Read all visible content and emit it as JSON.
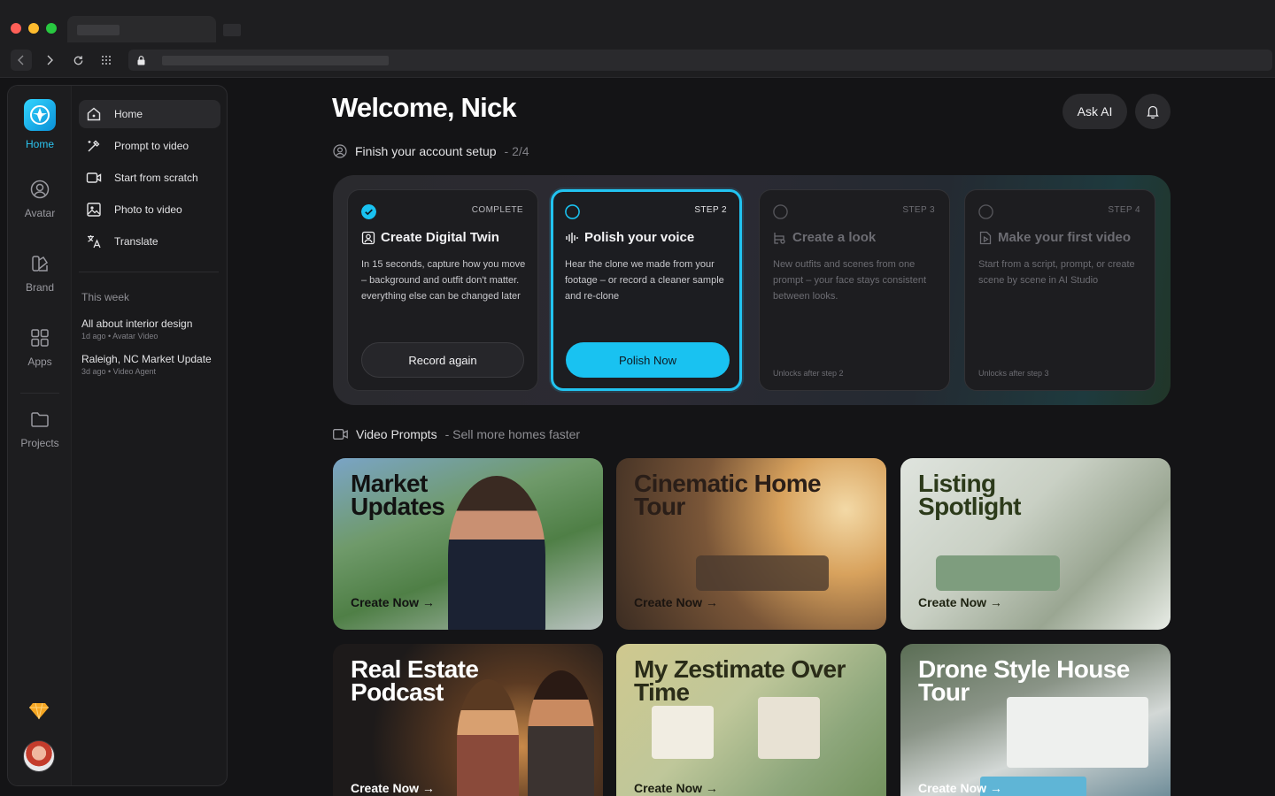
{
  "sidebar": {
    "rail": [
      {
        "label": "Home",
        "icon": "logo-icon",
        "active": true
      },
      {
        "label": "Avatar",
        "icon": "avatar-icon"
      },
      {
        "label": "Brand",
        "icon": "brand-icon"
      },
      {
        "label": "Apps",
        "icon": "apps-icon"
      },
      {
        "label": "Projects",
        "icon": "folder-icon"
      }
    ],
    "menu": [
      {
        "label": "Home",
        "icon": "home-icon",
        "active": true
      },
      {
        "label": "Prompt to video",
        "icon": "wand-icon"
      },
      {
        "label": "Start from scratch",
        "icon": "video-camera-icon"
      },
      {
        "label": "Photo to video",
        "icon": "image-icon"
      },
      {
        "label": "Translate",
        "icon": "translate-icon"
      }
    ],
    "week_heading": "This week",
    "recent": [
      {
        "title": "All about interior design",
        "meta": "1d ago • Avatar Video"
      },
      {
        "title": "Raleigh, NC Market Update",
        "meta": "3d ago • Video Agent"
      }
    ]
  },
  "header": {
    "welcome": "Welcome, Nick",
    "ask_ai": "Ask AI"
  },
  "setup": {
    "label": "Finish your account setup",
    "progress": "- 2/4"
  },
  "steps": [
    {
      "tag": "COMPLETE",
      "title": "Create Digital Twin",
      "desc": "In 15 seconds, capture how you move – background and outfit don't matter. everything else can be changed later",
      "button": "Record again"
    },
    {
      "tag": "STEP 2",
      "title": "Polish your voice",
      "desc": "Hear the clone we made from your footage – or record a cleaner sample and re-clone",
      "button": "Polish Now"
    },
    {
      "tag": "STEP 3",
      "title": "Create a look",
      "desc": "New outfits and scenes from one prompt – your face stays consistent between looks.",
      "unlock": "Unlocks after step 2"
    },
    {
      "tag": "STEP 4",
      "title": "Make your first video",
      "desc": "Start from a script, prompt, or create scene by scene in AI Studio",
      "unlock": "Unlocks after step 3"
    }
  ],
  "prompts": {
    "heading": "Video Prompts",
    "sub": "- Sell more homes faster",
    "tiles": [
      {
        "name": "Market Updates",
        "cta": "Create Now →"
      },
      {
        "name": "Cinematic Home Tour",
        "cta": "Create Now →"
      },
      {
        "name": "Listing Spotlight",
        "cta": "Create Now →"
      },
      {
        "name": "Real Estate Podcast",
        "cta": "Create Now →"
      },
      {
        "name": "My Zestimate Over Time",
        "cta": "Create Now →"
      },
      {
        "name": "Drone Style House Tour",
        "cta": "Create Now →"
      }
    ]
  },
  "colors": {
    "accent": "#19c2f1",
    "bg": "#141416",
    "brand_gem": "#f5a623"
  }
}
